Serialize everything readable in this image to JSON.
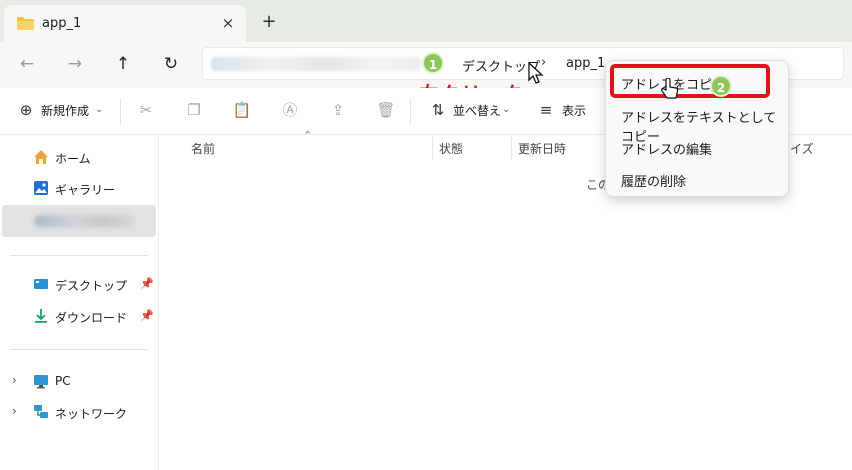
{
  "tab": {
    "title": "app_1",
    "close_icon": "×",
    "new_tab_icon": "+"
  },
  "nav": {
    "back": "←",
    "forward": "→",
    "up": "↑",
    "refresh": "↻"
  },
  "address": {
    "crumbs": [
      "デスクトップ",
      "app_1"
    ],
    "separator": "›"
  },
  "annotations": {
    "step1": "1",
    "step2": "2",
    "right_click": "右クリック",
    "highlight_color": "#e01318",
    "step_color": "#8fc65b"
  },
  "toolbar": {
    "new_label": "新規作成",
    "sort_label": "並べ替え",
    "view_label": "表示"
  },
  "sidebar": {
    "items": [
      {
        "label": "ホーム",
        "icon": "home-icon"
      },
      {
        "label": "ギャラリー",
        "icon": "gallery-icon"
      },
      {
        "label": "デスクトップ",
        "icon": "desktop-icon"
      },
      {
        "label": "ダウンロード",
        "icon": "download-icon"
      },
      {
        "label": "PC",
        "icon": "pc-icon"
      },
      {
        "label": "ネットワーク",
        "icon": "network-icon"
      }
    ]
  },
  "columns": [
    "名前",
    "状態",
    "更新日時",
    "イズ"
  ],
  "empty_text": "この",
  "context_menu": {
    "items": [
      "アドレスをコピー",
      "アドレスをテキストとしてコピー",
      "アドレスの編集",
      "履歴の削除"
    ]
  }
}
